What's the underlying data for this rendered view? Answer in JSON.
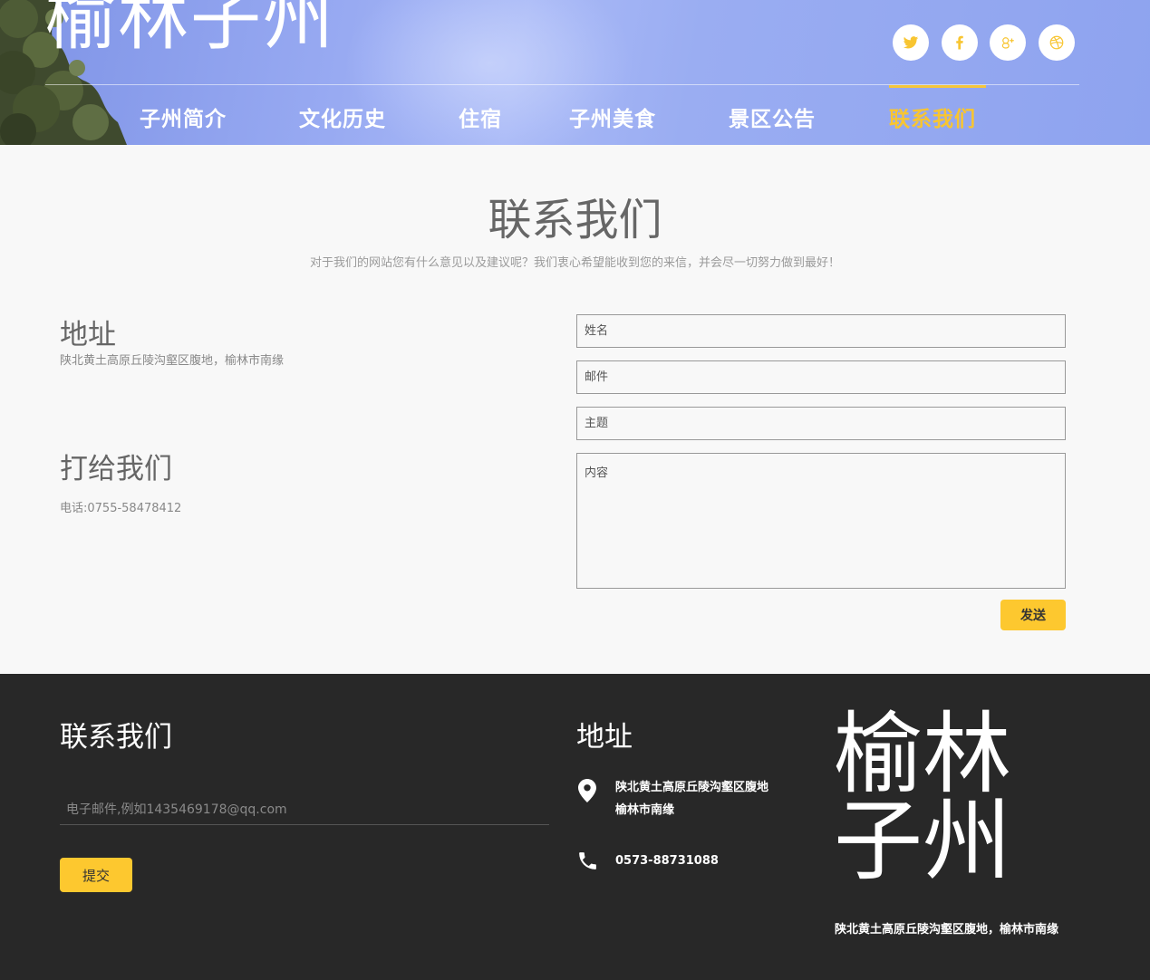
{
  "header": {
    "logo": "榆林子州",
    "nav": [
      {
        "label": "子州简介",
        "active": false
      },
      {
        "label": "文化历史",
        "active": false
      },
      {
        "label": "住宿",
        "active": false
      },
      {
        "label": "子州美食",
        "active": false
      },
      {
        "label": "景区公告",
        "active": false
      },
      {
        "label": "联系我们",
        "active": true
      }
    ],
    "social_icons": [
      "twitter-icon",
      "facebook-icon",
      "google-plus-icon",
      "dribbble-icon"
    ],
    "accent_color": "#f8c531"
  },
  "main": {
    "title": "联系我们",
    "subtitle": "对于我们的网站您有什么意见以及建议呢？我们衷心希望能收到您的来信，并会尽一切努力做到最好！",
    "address_heading": "地址",
    "address_text": "陕北黄土高原丘陵沟壑区腹地，榆林市南缘",
    "call_heading": "打给我们",
    "phone_text": "电话:0755-58478412",
    "form": {
      "name_placeholder": "姓名",
      "email_placeholder": "邮件",
      "subject_placeholder": "主题",
      "content_placeholder": "内容",
      "send_label": "发送"
    }
  },
  "footer": {
    "contact_heading": "联系我们",
    "email_placeholder": "电子邮件,例如1435469178@qq.com",
    "submit_label": "提交",
    "address_heading": "地址",
    "address_line1": "陕北黄土高原丘陵沟壑区腹地",
    "address_line2": "榆林市南缘",
    "phone": "0573-88731088",
    "logo_line1": "榆林",
    "logo_line2": "子州",
    "logo_address": "陕北黄土高原丘陵沟壑区腹地，榆林市南缘"
  }
}
